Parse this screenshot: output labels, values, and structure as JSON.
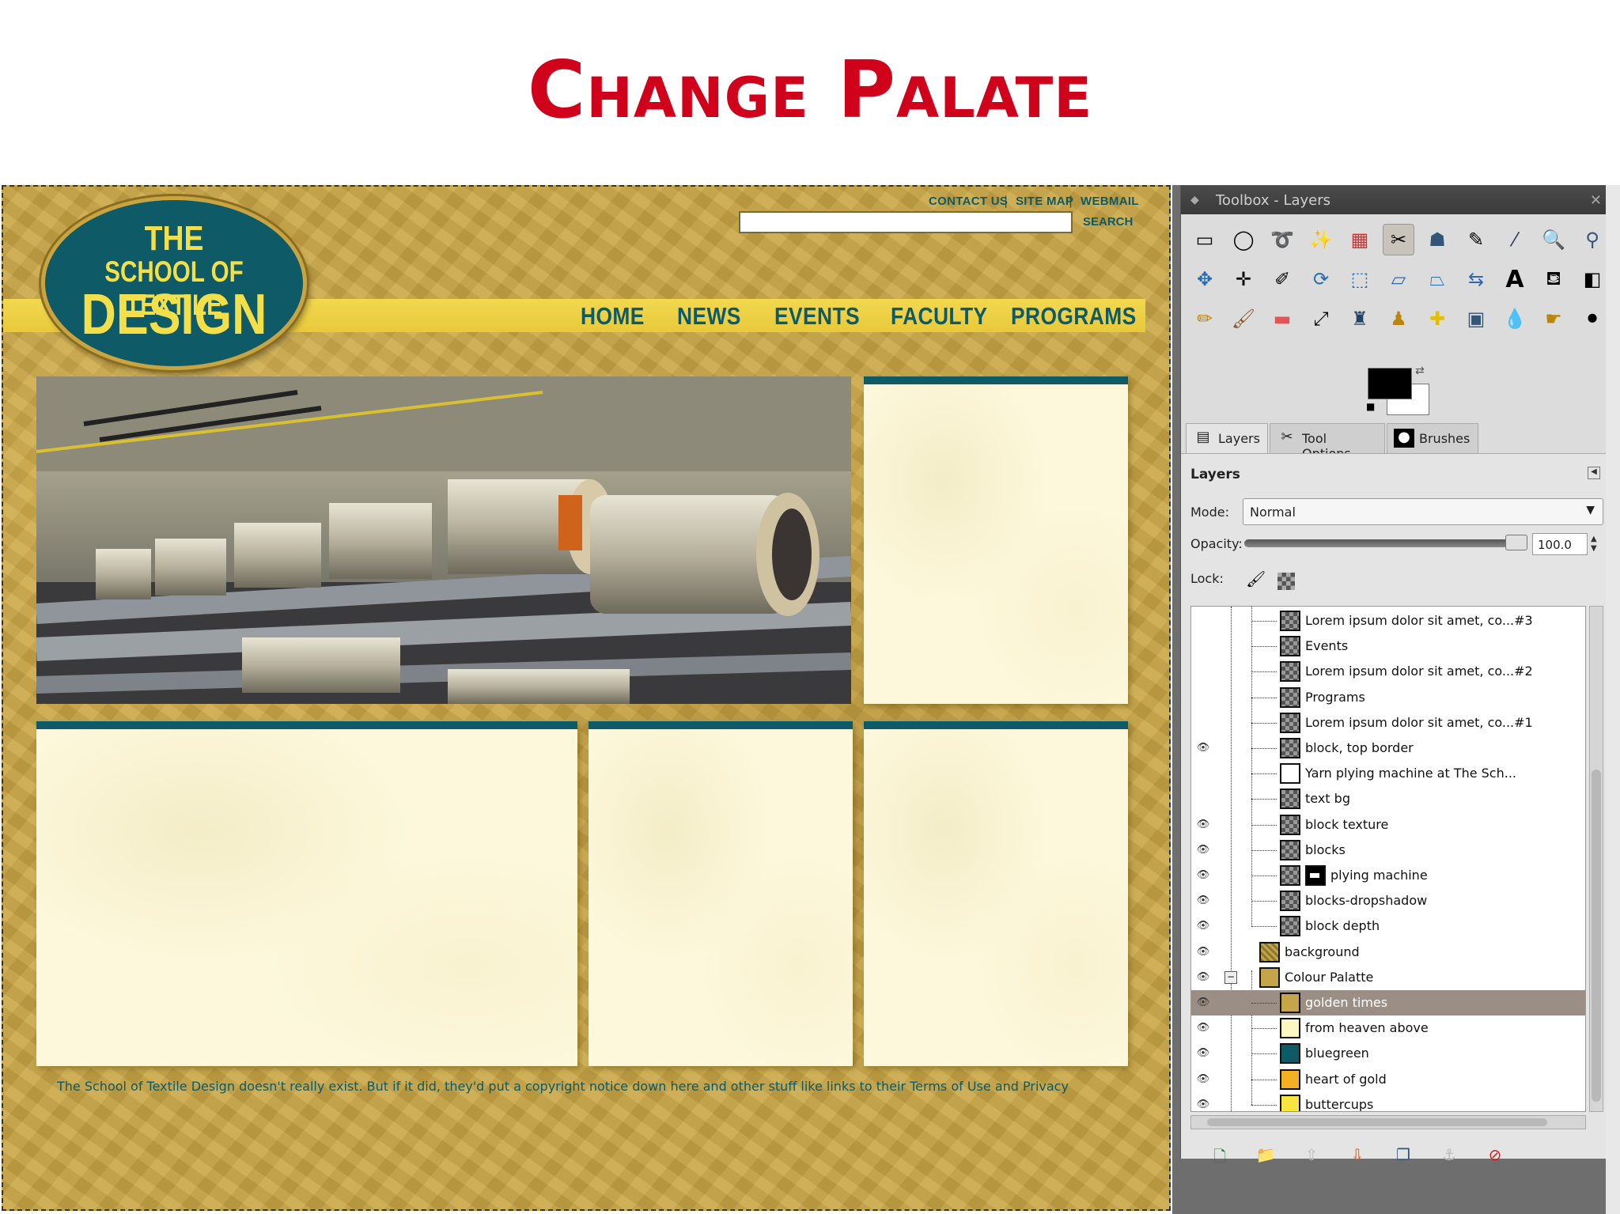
{
  "slide": {
    "title": "Change Palate"
  },
  "site": {
    "utility_links": [
      "CONTACT US",
      "SITE MAP",
      "WEBMAIL"
    ],
    "separator": "|",
    "search_label": "SEARCH",
    "search_value": "",
    "logo": {
      "line1": "THE",
      "line2": "SCHOOL OF TEXTILE",
      "line3": "DESIGN"
    },
    "nav": [
      "HOME",
      "NEWS",
      "EVENTS",
      "FACULTY",
      "PROGRAMS"
    ],
    "footer": "The School of Textile Design doesn't really exist. But if it did, they'd put a copyright notice down here and other stuff like links to their Terms of Use and Privacy",
    "colors": {
      "gold": "#c6a449",
      "teal": "#0e5a66",
      "cream": "#fdf8dc",
      "yellow": "#f2df4a"
    }
  },
  "gimp": {
    "window_title": "Toolbox - Layers",
    "tools": [
      "rect-select",
      "ellipse-select",
      "free-select",
      "fuzzy-select",
      "select-by-color",
      "scissors-select",
      "foreground-select",
      "paths",
      "color-picker",
      "zoom",
      "measure",
      "move",
      "align",
      "crop",
      "rotate",
      "scale",
      "shear",
      "perspective",
      "flip",
      "cage",
      "text",
      "bucket-fill",
      "blend",
      "pencil",
      "paintbrush",
      "eraser",
      "airbrush",
      "ink",
      "clone",
      "heal",
      "perspective-clone",
      "blur",
      "smudge",
      "dodge-burn"
    ],
    "tabs": [
      "Layers",
      "Tool Options",
      "Brushes"
    ],
    "panel_heading": "Layers",
    "mode_label": "Mode:",
    "mode_value": "Normal",
    "opacity_label": "Opacity:",
    "opacity_value": "100.0",
    "lock_label": "Lock:",
    "layers": [
      {
        "name": "Lorem ipsum dolor sit amet, co...#3",
        "visible": false
      },
      {
        "name": "Events",
        "visible": false
      },
      {
        "name": "Lorem ipsum dolor sit amet, co...#2",
        "visible": false
      },
      {
        "name": "Programs",
        "visible": false
      },
      {
        "name": "Lorem ipsum dolor sit amet, co...#1",
        "visible": false
      },
      {
        "name": "block, top border",
        "visible": true
      },
      {
        "name": "Yarn plying machine at The Sch...",
        "visible": false
      },
      {
        "name": "text bg",
        "visible": false
      },
      {
        "name": "block texture",
        "visible": true
      },
      {
        "name": "blocks",
        "visible": true
      },
      {
        "name": "plying machine",
        "visible": true
      },
      {
        "name": "blocks-dropshadow",
        "visible": true
      },
      {
        "name": "block depth",
        "visible": true
      },
      {
        "name": "background",
        "visible": true
      },
      {
        "name": "Colour Palatte",
        "visible": true
      },
      {
        "name": "golden times",
        "visible": true,
        "color": "#c6a449"
      },
      {
        "name": "from heaven above",
        "visible": true,
        "color": "#fff7c2"
      },
      {
        "name": "bluegreen",
        "visible": true,
        "color": "#0e5a66"
      },
      {
        "name": "heart of gold",
        "visible": true,
        "color": "#f5b021"
      },
      {
        "name": "buttercups",
        "visible": true,
        "color": "#f8e640"
      }
    ]
  }
}
